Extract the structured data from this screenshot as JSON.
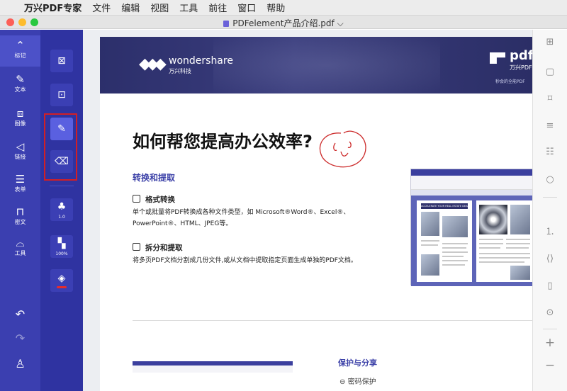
{
  "menubar": {
    "apple": "",
    "items": [
      "万兴PDF专家",
      "文件",
      "编辑",
      "视图",
      "工具",
      "前往",
      "窗口",
      "帮助"
    ]
  },
  "window": {
    "title": "PDFelement产品介绍.pdf",
    "title_chevron": "⌵",
    "traffic_lights": [
      "#fc5f57",
      "#fdbc2e",
      "#28c840"
    ]
  },
  "sidebar": {
    "items": [
      {
        "label": "标记",
        "icon": "markup-icon",
        "glyph": "⌃",
        "active": true
      },
      {
        "label": "文本",
        "icon": "pencil-text-icon",
        "glyph": "✎"
      },
      {
        "label": "图像",
        "icon": "image-icon",
        "glyph": "⧈"
      },
      {
        "label": "链接",
        "icon": "link-icon",
        "glyph": "◁"
      },
      {
        "label": "表单",
        "icon": "form-icon",
        "glyph": "☰"
      },
      {
        "label": "密文",
        "icon": "redact-icon",
        "glyph": "⊓"
      },
      {
        "label": "工具",
        "icon": "tools-icon",
        "glyph": "⌓"
      }
    ],
    "undo": "↶",
    "redo": "↷",
    "account": "♙"
  },
  "tools": [
    {
      "icon": "close-annotation-icon",
      "glyph": "⊠"
    },
    {
      "icon": "text-box-icon",
      "glyph": "⊡"
    },
    {
      "icon": "pencil-icon",
      "glyph": "✎",
      "selected": true
    },
    {
      "icon": "eraser-icon",
      "glyph": "⌫"
    },
    {
      "icon": "line-thickness-icon",
      "glyph": "♣",
      "value": "1.0"
    },
    {
      "icon": "opacity-icon",
      "glyph": "▚",
      "value": "100%"
    },
    {
      "icon": "fill-color-icon",
      "glyph": "◈"
    }
  ],
  "page": {
    "banner": {
      "brand": "wondershare",
      "brand_sub": "万兴科技",
      "product": "pdfe",
      "product_sub": "万兴PDF",
      "tagline": "秒会的全能PDF"
    },
    "heading": "如何帮您提高办公效率?",
    "section1": "转换和提取",
    "sub1": "格式转换",
    "para1_line1": "单个或批量将PDF转换成各种文件类型，如 Microsoft®Word®、Excel®、",
    "para1_line2": "PowerPoint®、HTML、JPEG等。",
    "sub2": "拆分和提取",
    "para2": "将多页PDF文档分割成几份文件,或从文档中提取指定页面生成单独的PDF文档。",
    "section2": "保护与分享",
    "section2_item": "密码保护",
    "embedded_title": "ACCELERATE YOUR REAL ESTATE DEALS"
  },
  "right_panel": [
    {
      "icon": "grid-view-icon",
      "glyph": "⊞"
    },
    {
      "icon": "page-icon",
      "glyph": "▢"
    },
    {
      "icon": "bookmark-icon",
      "glyph": "⌑"
    },
    {
      "icon": "outline-icon",
      "glyph": "≡"
    },
    {
      "icon": "list-icon",
      "glyph": "☷"
    },
    {
      "icon": "search-icon",
      "glyph": "○"
    },
    {
      "icon": "page-number-icon",
      "glyph": "⒈"
    },
    {
      "icon": "code-icon",
      "glyph": "⟨⟩"
    },
    {
      "icon": "document-icon",
      "glyph": "▯"
    },
    {
      "icon": "scan-icon",
      "glyph": "⊙"
    },
    {
      "icon": "zoom-in-icon",
      "glyph": "+"
    },
    {
      "icon": "zoom-out-icon",
      "glyph": "−"
    }
  ]
}
